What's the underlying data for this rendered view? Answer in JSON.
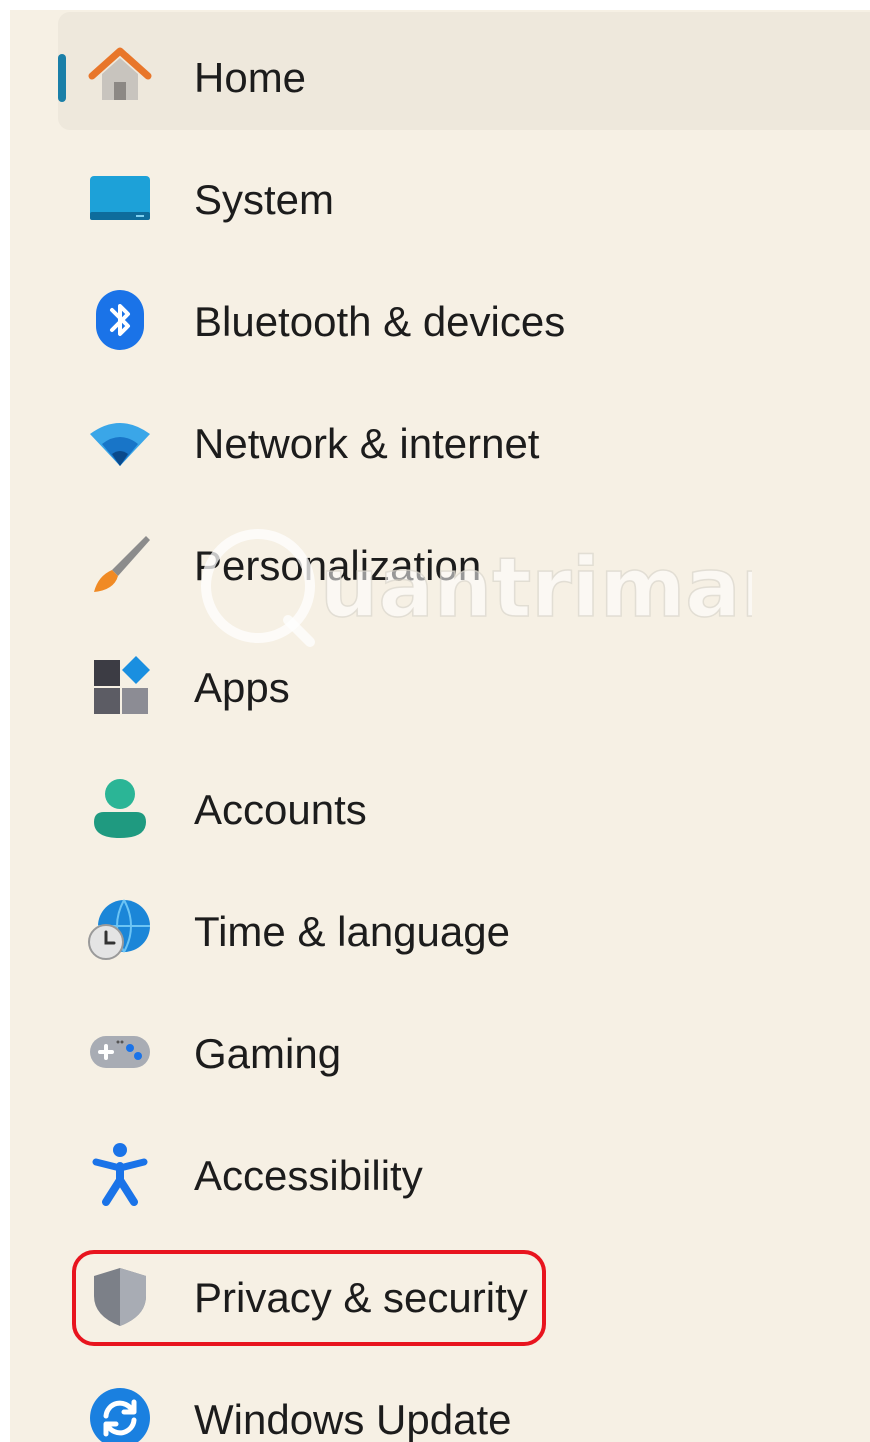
{
  "nav": {
    "items": [
      {
        "label": "Home",
        "icon": "home-icon",
        "selected": true
      },
      {
        "label": "System",
        "icon": "system-icon"
      },
      {
        "label": "Bluetooth & devices",
        "icon": "bluetooth-icon"
      },
      {
        "label": "Network & internet",
        "icon": "wifi-icon"
      },
      {
        "label": "Personalization",
        "icon": "paintbrush-icon"
      },
      {
        "label": "Apps",
        "icon": "apps-icon"
      },
      {
        "label": "Accounts",
        "icon": "user-icon"
      },
      {
        "label": "Time & language",
        "icon": "globe-clock-icon"
      },
      {
        "label": "Gaming",
        "icon": "gamepad-icon"
      },
      {
        "label": "Accessibility",
        "icon": "accessibility-icon"
      },
      {
        "label": "Privacy & security",
        "icon": "shield-icon",
        "highlighted": true
      },
      {
        "label": "Windows Update",
        "icon": "windows-update-icon"
      }
    ]
  },
  "highlight_color": "#e8141e",
  "selection_color": "#1a7fa8",
  "background_color": "#f6f0e4",
  "watermark": {
    "text": "uantrimang",
    "icon": "quantrimang-watermark-logo"
  }
}
